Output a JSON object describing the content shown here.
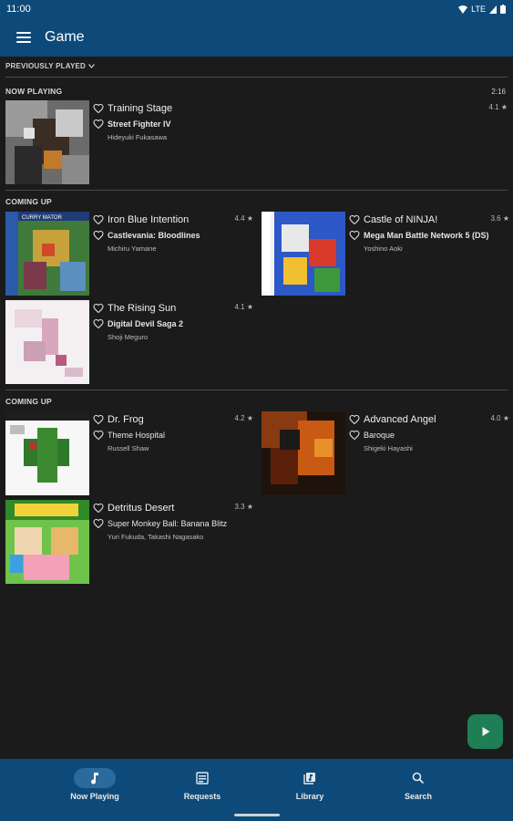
{
  "status_bar": {
    "time": "11:00",
    "network": "LTE"
  },
  "app_bar": {
    "title": "Game"
  },
  "previously_played": "PREVIOUSLY PLAYED",
  "now_playing": {
    "section": "NOW PLAYING",
    "elapsed": "2:16",
    "item": {
      "song": "Training Stage",
      "game": "Street Fighter IV",
      "artist": "Hideyuki Fukasawa",
      "rating": "4.1 ★"
    }
  },
  "coming_up_1": {
    "section": "COMING UP",
    "items": [
      {
        "song": "Iron Blue Intention",
        "game": "Castlevania: Bloodlines",
        "artist": "Michiru Yamane",
        "rating": "4.4 ★"
      },
      {
        "song": "Castle of NINJA!",
        "game": "Mega Man Battle Network 5 (DS)",
        "artist": "Yoshino Aoki",
        "rating": "3.6 ★"
      },
      {
        "song": "The Rising Sun",
        "game": "Digital Devil Saga 2",
        "artist": "Shoji Meguro",
        "rating": "4.1 ★"
      }
    ]
  },
  "coming_up_2": {
    "section": "COMING UP",
    "items": [
      {
        "song": "Dr. Frog",
        "game": "Theme Hospital",
        "artist": "Russell Shaw",
        "rating": "4.2 ★"
      },
      {
        "song": "Advanced Angel",
        "game": "Baroque",
        "artist": "Shigeki Hayashi",
        "rating": "4.0 ★"
      },
      {
        "song": "Detritus Desert",
        "game": "Super Monkey Ball: Banana Blitz",
        "artist": "Yuri Fukuda, Takashi Nagasako",
        "rating": "3.3 ★"
      }
    ]
  },
  "nav": [
    {
      "label": "Now Playing",
      "icon": "music-note-icon"
    },
    {
      "label": "Requests",
      "icon": "requests-icon"
    },
    {
      "label": "Library",
      "icon": "library-icon"
    },
    {
      "label": "Search",
      "icon": "search-icon"
    }
  ],
  "colors": {
    "app_bar": "#0d4a7a",
    "background": "#1b1b1c",
    "fab": "#1e7f55",
    "nav_active": "#2c6a9b"
  }
}
